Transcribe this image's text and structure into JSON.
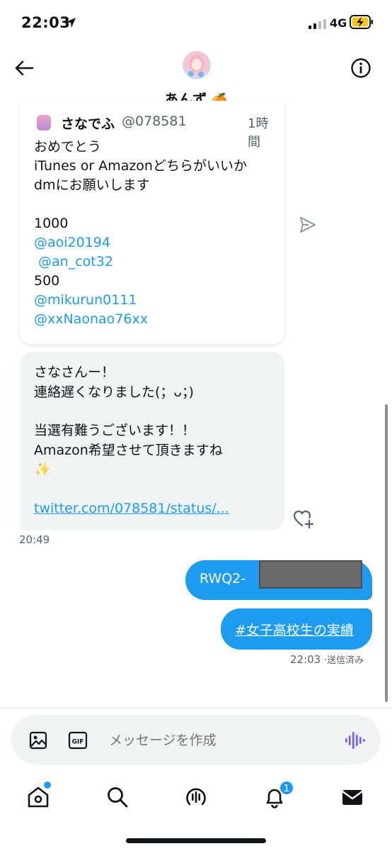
{
  "status_bar": {
    "time": "22:03",
    "network": "4G"
  },
  "header": {
    "name": "あんず",
    "name_emoji": "🍊"
  },
  "quoted_tweet": {
    "name": "さなでふ",
    "handle": "@078581",
    "time": "1時間",
    "lines": [
      {
        "text": "おめでとう",
        "type": "text"
      },
      {
        "text": "iTunes or Amazonどちらがいいか",
        "type": "text"
      },
      {
        "text": "dmにお願いします",
        "type": "text"
      },
      {
        "text": "",
        "type": "blank"
      },
      {
        "text": "1000",
        "type": "text"
      },
      {
        "text": "@aoi20194",
        "type": "mention"
      },
      {
        "text": " @an_cot32",
        "type": "mention"
      },
      {
        "text": "500",
        "type": "text"
      },
      {
        "text": "@mikurun0111",
        "type": "mention"
      },
      {
        "text": "@xxNaonao76xx",
        "type": "mention"
      }
    ]
  },
  "incoming_message": {
    "lines": [
      "さなさんー！",
      "連絡遅くなりました(；ᴗ；)",
      "",
      "当選有難うございます！！",
      "Amazon希望させて頂きますね",
      "✨",
      ""
    ],
    "link": "twitter.com/078581/status/...",
    "time": "20:49"
  },
  "outgoing_messages": [
    {
      "text": "RWQ2-"
    },
    {
      "text": "#女子高校生の実績"
    }
  ],
  "outgoing_meta": {
    "time": "22:03",
    "status": "·送信済み"
  },
  "composer": {
    "placeholder": "メッセージを作成"
  },
  "bottom_nav": {
    "notifications_badge": "1"
  },
  "colors": {
    "accent": "#1d9bf0",
    "voice": "#7856ff"
  }
}
